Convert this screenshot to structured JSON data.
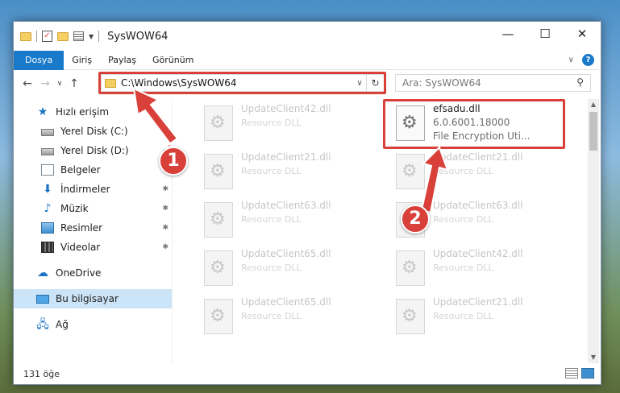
{
  "window": {
    "title": "SysWOW64",
    "controls": {
      "minimize": "—",
      "maximize": "☐",
      "close": "✕"
    }
  },
  "ribbon": {
    "tabs": [
      "Dosya",
      "Giriş",
      "Paylaş",
      "Görünüm"
    ],
    "collapse_icon": "chevron-down-icon",
    "help_label": "?"
  },
  "address": {
    "path": "C:\\Windows\\SysWOW64",
    "refresh_label": "↻",
    "dropdown_label": "∨"
  },
  "search": {
    "placeholder": "Ara: SysWOW64"
  },
  "nav": {
    "items": [
      {
        "label": "Hızlı erişim",
        "icon": "star-icon",
        "pinned": false
      },
      {
        "label": "Yerel Disk (C:)",
        "icon": "disk-icon",
        "pinned": true
      },
      {
        "label": "Yerel Disk (D:)",
        "icon": "disk-icon",
        "pinned": true
      },
      {
        "label": "Belgeler",
        "icon": "documents-icon",
        "pinned": true
      },
      {
        "label": "İndirmeler",
        "icon": "download-icon",
        "pinned": true
      },
      {
        "label": "Müzik",
        "icon": "music-icon",
        "pinned": true
      },
      {
        "label": "Resimler",
        "icon": "pictures-icon",
        "pinned": true
      },
      {
        "label": "Videolar",
        "icon": "videos-icon",
        "pinned": true
      },
      {
        "label": "OneDrive",
        "icon": "cloud-icon",
        "pinned": false
      },
      {
        "label": "Bu bilgisayar",
        "icon": "computer-icon",
        "pinned": false,
        "selected": true
      },
      {
        "label": "Ağ",
        "icon": "network-icon",
        "pinned": false
      }
    ]
  },
  "files": {
    "left_column": [
      {
        "name": "UpdateClient42.dll",
        "type": "Resource DLL"
      },
      {
        "name": "UpdateClient21.dll",
        "type": "Resource DLL"
      },
      {
        "name": "UpdateClient63.dll",
        "type": "Resource DLL"
      },
      {
        "name": "UpdateClient65.dll",
        "type": "Resource DLL"
      },
      {
        "name": "UpdateClient65.dll",
        "type": "Resource DLL"
      }
    ],
    "right_column": [
      {
        "name": "efsadu.dll",
        "version": "6.0.6001.18000",
        "type": "File Encryption Uti..."
      },
      {
        "name": "UpdateClient21.dll",
        "type": "Resource DLL"
      },
      {
        "name": "UpdateClient63.dll",
        "type": "Resource DLL"
      },
      {
        "name": "UpdateClient42.dll",
        "type": "Resource DLL"
      },
      {
        "name": "UpdateClient21.dll",
        "type": "Resource DLL"
      }
    ]
  },
  "status": {
    "item_count": "131 öğe"
  },
  "annotations": {
    "step1": "1",
    "step2": "2",
    "highlight_color": "#d9403a"
  }
}
